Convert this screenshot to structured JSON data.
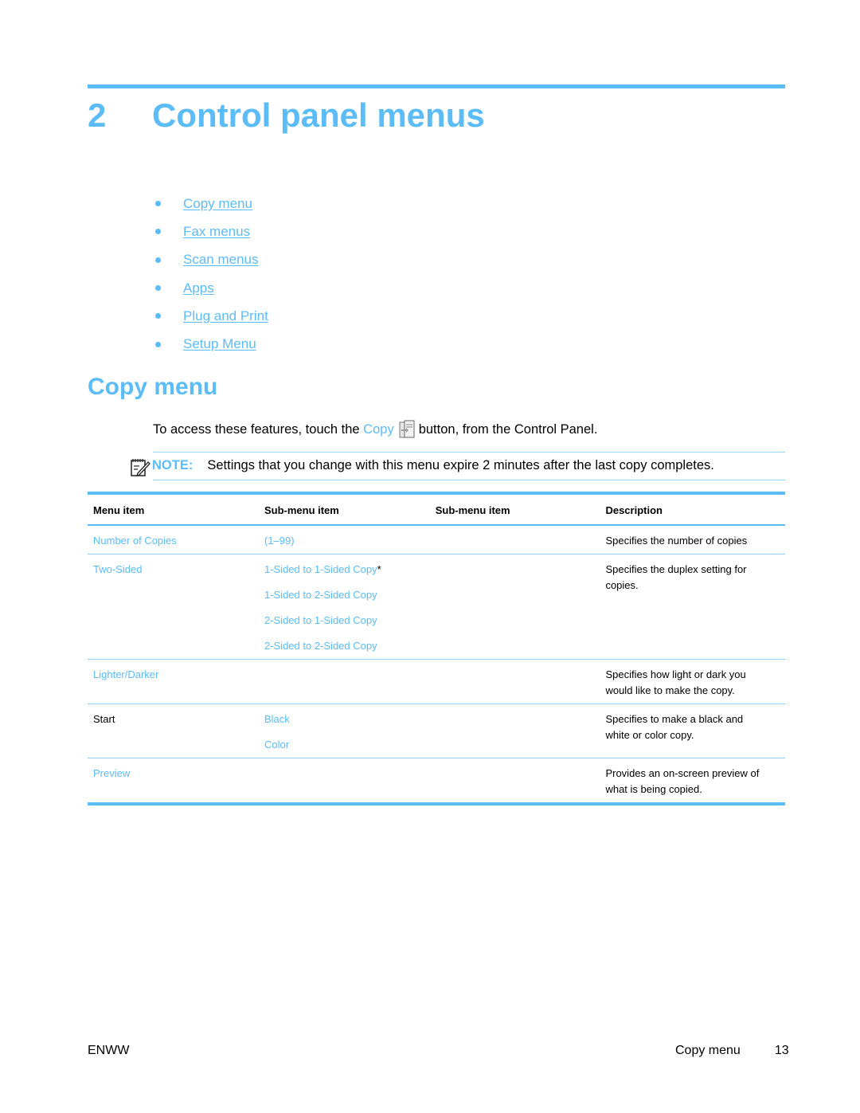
{
  "chapter": {
    "number": "2",
    "title": "Control panel menus"
  },
  "toc": [
    {
      "label": "Copy menu"
    },
    {
      "label": "Fax menus"
    },
    {
      "label": "Scan menus"
    },
    {
      "label": "Apps"
    },
    {
      "label": "Plug and Print"
    },
    {
      "label": "Setup Menu"
    }
  ],
  "section": {
    "title": "Copy menu",
    "intro_before": "To access these features, touch the",
    "intro_link": "Copy",
    "intro_icon": "copy-button-icon",
    "intro_after": "button, from the Control Panel.",
    "note_icon": "note-pencil-icon",
    "note_label": "NOTE:",
    "note_text": "Settings that you change with this menu expire 2 minutes after the last copy completes."
  },
  "table": {
    "headers": [
      "Menu item",
      "Sub-menu item",
      "Sub-menu item",
      "Description"
    ],
    "rows": [
      {
        "menu_item": "Number of Copies",
        "menu_item_link": true,
        "submenu": [
          "(1–99)"
        ],
        "submenu_link": true,
        "submenu2": [],
        "description": "Specifies the number of copies"
      },
      {
        "menu_item": "Two-Sided",
        "menu_item_link": true,
        "submenu": [
          "1-Sided to 1-Sided Copy",
          "1-Sided to 2-Sided Copy",
          "2-Sided to 1-Sided Copy",
          "2-Sided to 2-Sided Copy"
        ],
        "submenu_default_marker": "*",
        "submenu_link": true,
        "submenu2": [],
        "description": "Specifies the duplex setting for copies."
      },
      {
        "menu_item": "Lighter/Darker",
        "menu_item_link": true,
        "submenu": [],
        "submenu2": [],
        "description": "Specifies how light or dark you would like to make the copy."
      },
      {
        "menu_item": "Start",
        "menu_item_link": false,
        "submenu": [
          "Black",
          "Color"
        ],
        "submenu_link": true,
        "submenu2": [],
        "description": "Specifies to make a black and white or color copy."
      },
      {
        "menu_item": "Preview",
        "menu_item_link": true,
        "submenu": [],
        "submenu2": [],
        "description": "Provides an on-screen preview of what is being copied."
      }
    ]
  },
  "footer": {
    "left": "ENWW",
    "section": "Copy menu",
    "page": "13"
  },
  "colors": {
    "accent": "#5bbcf7",
    "rule_light": "#8ed1fa",
    "text": "#000000"
  }
}
